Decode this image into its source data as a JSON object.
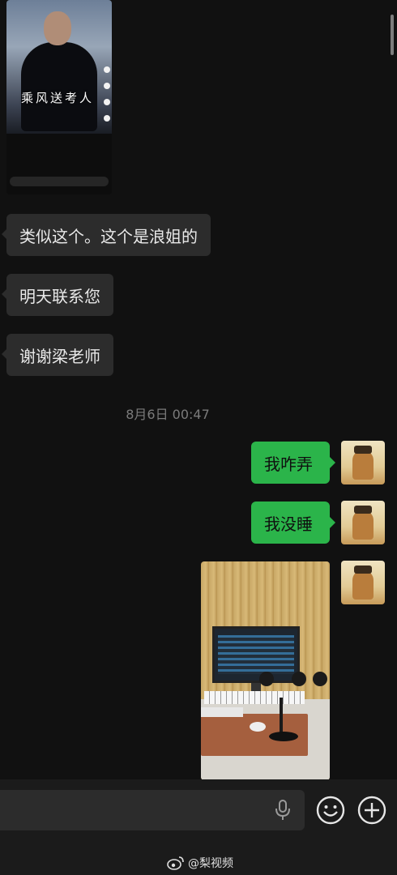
{
  "video_thumbnail": {
    "title": "乘风送考人"
  },
  "messages_received": [
    {
      "text": "类似这个。这个是浪姐的"
    },
    {
      "text": "明天联系您"
    },
    {
      "text": "谢谢梁老师"
    }
  ],
  "timestamp": "8月6日 00:47",
  "messages_sent": [
    {
      "text": "我咋弄"
    },
    {
      "text": "我没睡"
    }
  ],
  "watermark": {
    "text": "@梨视频"
  },
  "icons": {
    "voice": "microphone-icon",
    "emoji": "emoji-icon",
    "more": "plus-icon",
    "weibo": "weibo-logo-icon"
  },
  "colors": {
    "background": "#111111",
    "received_bubble": "#2c2c2c",
    "sent_bubble": "#2bb44a",
    "timestamp": "#7b7b7b"
  }
}
